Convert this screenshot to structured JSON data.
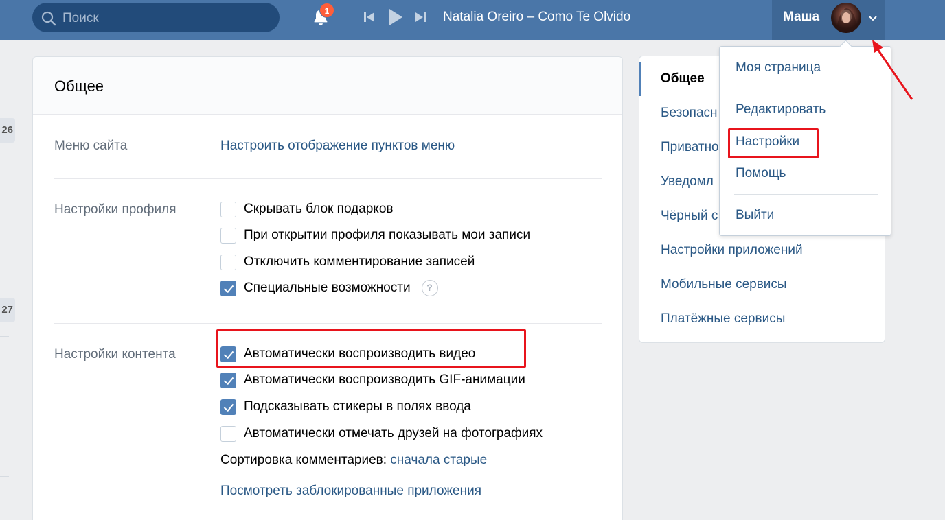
{
  "header": {
    "search_placeholder": "Поиск",
    "notification_count": "1",
    "track_title": "Natalia Oreiro – Como Te Olvido",
    "user_name": "Маша"
  },
  "left_stubs": [
    "26",
    "27"
  ],
  "general": {
    "title": "Общее",
    "site_menu": {
      "label": "Меню сайта",
      "link": "Настроить отображение пунктов меню"
    },
    "profile_settings": {
      "label": "Настройки профиля",
      "options": [
        {
          "text": "Скрывать блок подарков",
          "checked": false
        },
        {
          "text": "При открытии профиля показывать мои записи",
          "checked": false
        },
        {
          "text": "Отключить комментирование записей",
          "checked": false
        },
        {
          "text": "Специальные возможности",
          "checked": true
        }
      ],
      "help": "?"
    },
    "content_settings": {
      "label": "Настройки контента",
      "options": [
        {
          "text": "Автоматически воспроизводить видео",
          "checked": true
        },
        {
          "text": "Автоматически воспроизводить GIF-анимации",
          "checked": true
        },
        {
          "text": "Подсказывать стикеры в полях ввода",
          "checked": true
        },
        {
          "text": "Автоматически отмечать друзей на фотографиях",
          "checked": false
        }
      ],
      "sort_label": "Сортировка комментариев:",
      "sort_value": "сначала старые",
      "blocked_apps": "Посмотреть заблокированные приложения"
    }
  },
  "side_menu": {
    "items": [
      "Общее",
      "Безопасн",
      "Приватно",
      "Уведомл",
      "Чёрный с",
      "Настройки приложений",
      "Мобильные сервисы",
      "Платёжные сервисы"
    ]
  },
  "dropdown": {
    "items": [
      "Моя страница",
      "Редактировать",
      "Настройки",
      "Помощь",
      "Выйти"
    ]
  },
  "colors": {
    "header": "#4a76a8",
    "link": "#2a5885",
    "checkbox_on": "#5181b8",
    "highlight": "#e8141c"
  }
}
